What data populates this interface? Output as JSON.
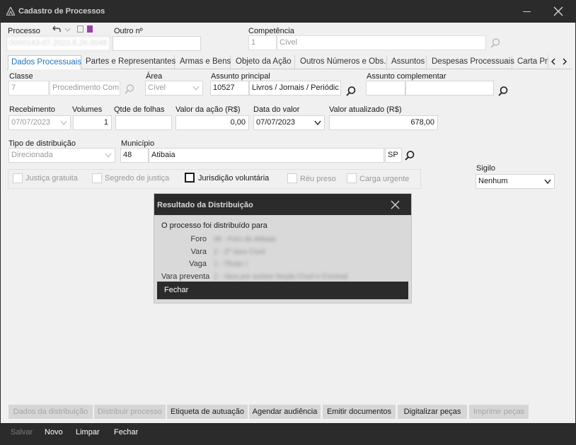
{
  "window": {
    "title": "Cadastro de Processos"
  },
  "header": {
    "processo_label": "Processo",
    "processo_value": "0000143-07.2023.8.26.0048",
    "outro_label": "Outro nº",
    "outro_value": "",
    "competencia_label": "Competência",
    "competencia_code": "1",
    "competencia_name": "Cível"
  },
  "tabs": [
    {
      "label": "Dados Processuais"
    },
    {
      "label": "Partes e Representantes"
    },
    {
      "label": "Armas e Bens"
    },
    {
      "label": "Objeto da Ação"
    },
    {
      "label": "Outros Números e Obs."
    },
    {
      "label": "Assuntos"
    },
    {
      "label": "Despesas Processuais"
    },
    {
      "label": "Carta Pr"
    }
  ],
  "form": {
    "classe_label": "Classe",
    "classe_code": "7",
    "classe_name": "Procedimento Com",
    "area_label": "Área",
    "area_value": "Cível",
    "assunto_label": "Assunto principal",
    "assunto_code": "10527",
    "assunto_name": "Livros / Jornais / Periódic",
    "assunto_comp_label": "Assunto complementar",
    "assunto_comp_code": "",
    "assunto_comp_name": "",
    "recebimento_label": "Recebimento",
    "recebimento_value": "07/07/2023",
    "volumes_label": "Volumes",
    "volumes_value": "1",
    "folhas_label": "Qtde de folhas",
    "folhas_value": "",
    "valor_acao_label": "Valor da ação (R$)",
    "valor_acao_value": "0,00",
    "data_valor_label": "Data do valor",
    "data_valor_value": "07/07/2023",
    "valor_atual_label": "Valor atualizado (R$)",
    "valor_atual_value": "678,00",
    "tipo_dist_label": "Tipo de distribuição",
    "tipo_dist_value": "Direcionada",
    "municipio_label": "Município",
    "municipio_code": "48",
    "municipio_name": "Atibaia",
    "municipio_uf": "SP",
    "sigilo_label": "Sigilo",
    "sigilo_value": "Nenhum"
  },
  "checkboxes": [
    {
      "label": "Justiça gratuita",
      "checked": false
    },
    {
      "label": "Segredo de justiça",
      "checked": false
    },
    {
      "label": "Jurisdição voluntária",
      "checked": false
    },
    {
      "label": "Réu preso",
      "checked": false
    },
    {
      "label": "Carga urgente",
      "checked": false
    }
  ],
  "action_buttons": [
    {
      "label": "Dados da distribuição",
      "enabled": false
    },
    {
      "label": "Distribuir processo",
      "enabled": false
    },
    {
      "label": "Etiqueta de autuação",
      "enabled": true
    },
    {
      "label": "Agendar audiência",
      "enabled": true
    },
    {
      "label": "Emitir documentos",
      "enabled": true
    },
    {
      "label": "Digitalizar peças",
      "enabled": true
    },
    {
      "label": "Imprimir peças",
      "enabled": false
    }
  ],
  "footer": [
    {
      "label": "Salvar",
      "enabled": false
    },
    {
      "label": "Novo",
      "enabled": true
    },
    {
      "label": "Limpar",
      "enabled": true
    },
    {
      "label": "Fechar",
      "enabled": true
    }
  ],
  "modal": {
    "title": "Resultado da Distribuição",
    "message": "O processo foi distribuído para",
    "foro_label": "Foro",
    "foro_value": "48 - Foro de Atibaia",
    "vara_label": "Vara",
    "vara_value": "2 - 2ª Vara Cível",
    "vaga_label": "Vaga",
    "vaga_value": "1 - Titular I",
    "preventa_label": "Vara preventa",
    "preventa_value": "2 - Vara por sorteio Seção Cível e Criminal",
    "button_label": "Fechar"
  },
  "colors": {
    "dark": "#2b2b2b",
    "accent": "#1e73be",
    "panel": "#f0f0f0"
  }
}
